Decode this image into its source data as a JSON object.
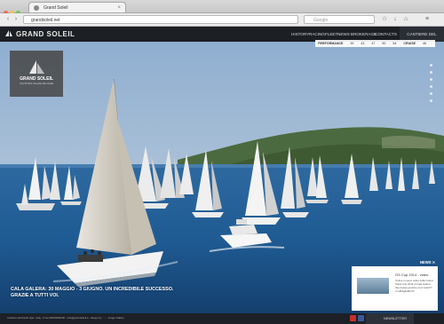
{
  "browser": {
    "tab_title": "Grand Soleil",
    "url": "grandsoleil.net",
    "search_placeholder": "Google"
  },
  "site": {
    "logo_text": "GRAND SOLEIL",
    "nav": [
      "HISTORY",
      "RACING",
      "FLEET",
      "NEWS",
      "BROKERAGE",
      "CONTACTS"
    ],
    "cta": "CANTIERE DEL PARDO"
  },
  "performance": {
    "label": "PERFORMANCE",
    "sizes": [
      "39",
      "43",
      "47",
      "50",
      "54"
    ],
    "cruise_label": "CRUISE",
    "cruise_size": "46"
  },
  "badge": {
    "title": "GRAND SOLEIL",
    "subtitle": "UNA STORIA ITALIANA DEL MARE"
  },
  "hero": {
    "caption_line1": "CALA GALERA: 30 MAGGIO - 3 GIUGNO. UN INCREDIBILE SUCCESSO.",
    "caption_line2": "GRAZIE A TUTTI VOI."
  },
  "news": {
    "label": "NEWS",
    "title": "GS Cup 2014 - video",
    "body": "Online il nuovo video della Grand Soleil Cup 2014 di Cala Galera: http://www.youtube.com/ watch?v=mB4g6wBoX0"
  },
  "footer": {
    "text": "Cantiere del Pardo Spa - Italy - P.iva 00000000000 - info@grandsoleil.it - design by ..... - Image Gallery",
    "newsletter": "NEWSLETTER"
  },
  "colors": {
    "header_bg": "#1c1f24",
    "sea": "#1f5b93",
    "sky": "#b9c9d8"
  }
}
